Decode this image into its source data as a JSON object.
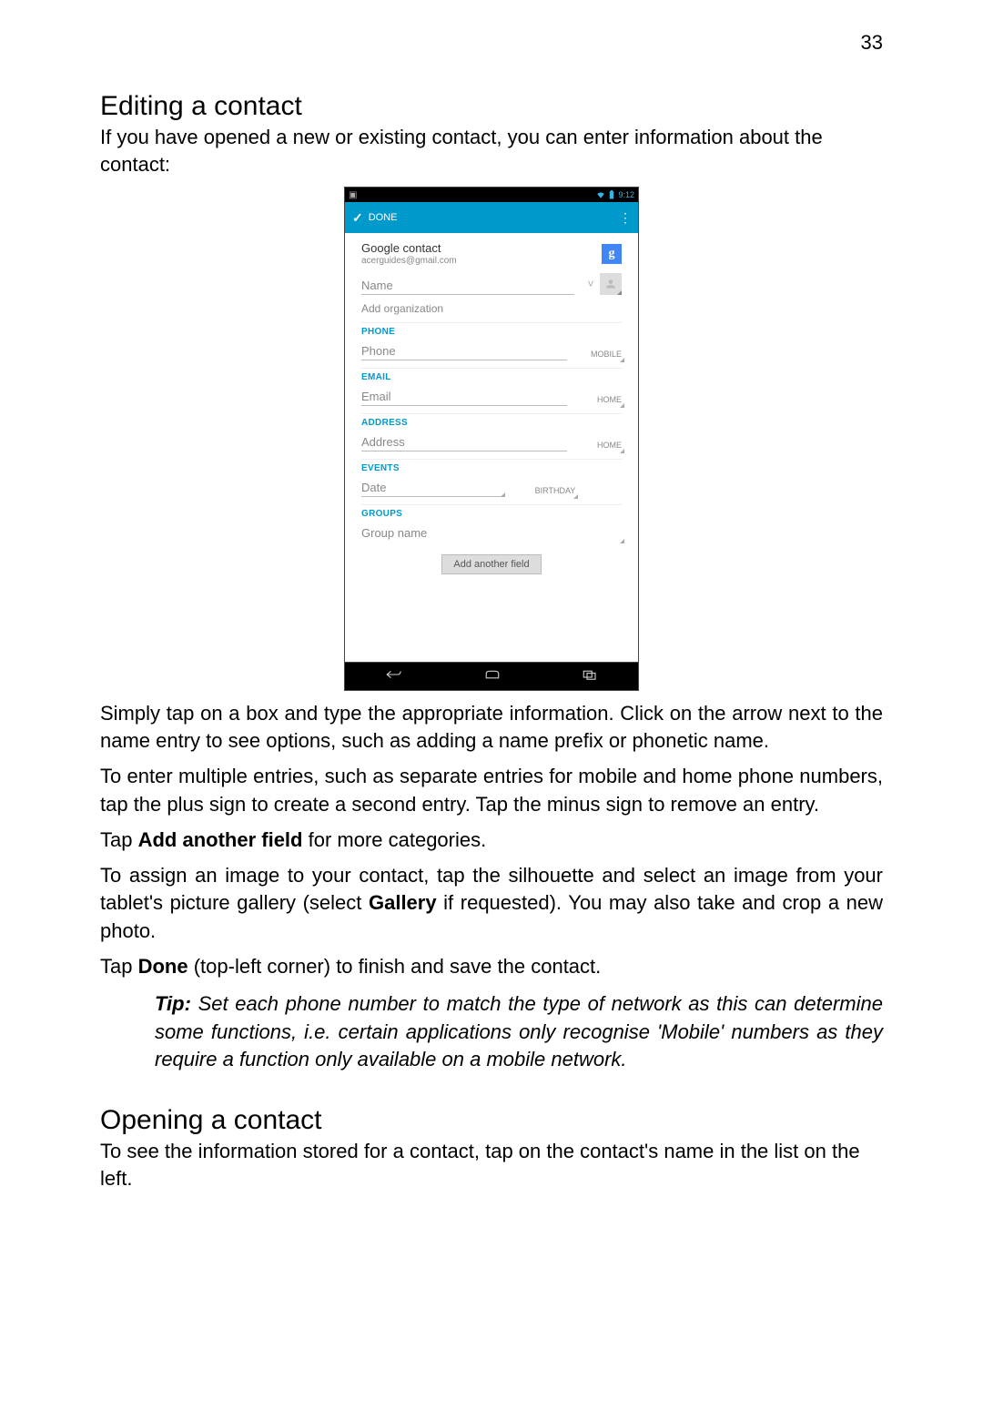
{
  "page_number": "33",
  "section1_title": "Editing a contact",
  "intro1": "If you have opened a new or existing contact, you can enter information about the contact:",
  "statusbar_time": "9:12",
  "actionbar": {
    "done": "DONE"
  },
  "account": {
    "title": "Google contact",
    "subtitle": "acerguides@gmail.com",
    "badge": "g"
  },
  "fields": {
    "name_placeholder": "Name",
    "add_org": "Add organization",
    "phone_header": "PHONE",
    "phone_placeholder": "Phone",
    "phone_type": "MOBILE",
    "email_header": "EMAIL",
    "email_placeholder": "Email",
    "email_type": "HOME",
    "address_header": "ADDRESS",
    "address_placeholder": "Address",
    "address_type": "HOME",
    "events_header": "EVENTS",
    "events_placeholder": "Date",
    "events_type": "BIRTHDAY",
    "groups_header": "GROUPS",
    "groups_placeholder": "Group name"
  },
  "add_another_field_btn": "Add another field",
  "para1": "Simply tap on a box and type the appropriate information. Click on the arrow next to the name entry to see options, such as adding a name prefix or phonetic name.",
  "para2": "To enter multiple entries, such as separate entries for mobile and home phone numbers, tap the plus sign to create a second entry. Tap the minus sign to remove an entry.",
  "para3_pre": "Tap ",
  "para3_bold": "Add another field",
  "para3_post": " for more categories.",
  "para4_pre": "To assign an image to your contact, tap the silhouette and select an image from your tablet's picture gallery (select ",
  "para4_bold": "Gallery",
  "para4_post": " if requested). You may also take and crop a new photo.",
  "para5_pre": "Tap ",
  "para5_bold": "Done",
  "para5_post": " (top-left corner) to finish and save the contact.",
  "tip_label": "Tip:",
  "tip_text": " Set each phone number to match the type of network as this can determine some functions, i.e. certain applications only recognise 'Mobile' numbers as they require a function only available on a mobile network.",
  "section2_title": "Opening a contact",
  "section2_text": "To see the information stored for a contact, tap on the contact's name in the list on the left."
}
